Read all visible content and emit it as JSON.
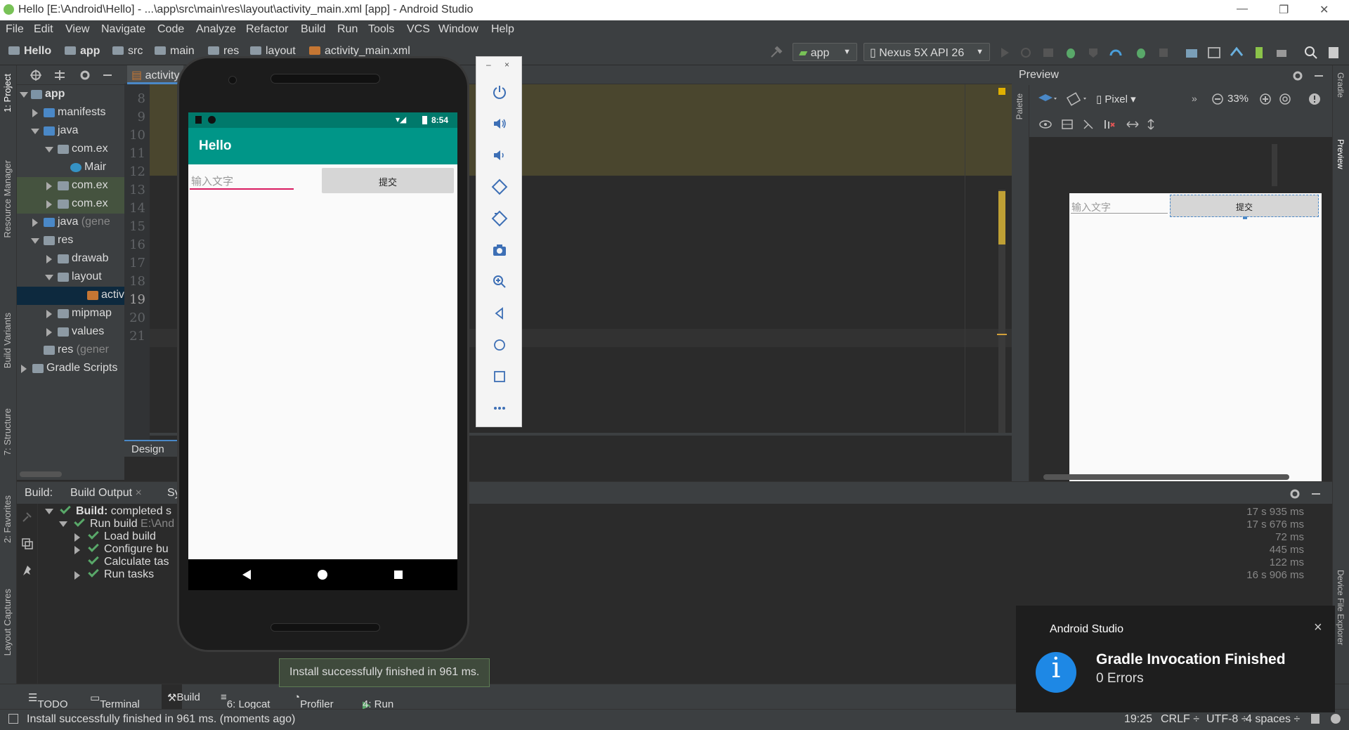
{
  "title_bar": {
    "title": "Hello [E:\\Android\\Hello] - ...\\app\\src\\main\\res\\layout\\activity_main.xml [app] - Android Studio",
    "minimize": "—",
    "restore": "❐",
    "close": "✕"
  },
  "menu": [
    "File",
    "Edit",
    "View",
    "Navigate",
    "Code",
    "Analyze",
    "Refactor",
    "Build",
    "Run",
    "Tools",
    "VCS",
    "Window",
    "Help"
  ],
  "breadcrumb": [
    "Hello",
    "app",
    "src",
    "main",
    "res",
    "layout",
    "activity_main.xml"
  ],
  "toolbar": {
    "run_config": "app",
    "device": "Nexus 5X API 26"
  },
  "left_tabs": [
    "1: Project",
    "Resource Manager",
    "Build Variants",
    "7: Structure",
    "2: Favorites",
    "Layout Captures"
  ],
  "right_tabs": [
    "Gradle",
    "Preview",
    "Device File Explorer"
  ],
  "project_tree": [
    {
      "label": "app",
      "depth": 0,
      "open": true,
      "bold": true
    },
    {
      "label": "manifests",
      "depth": 1,
      "open": false
    },
    {
      "label": "java",
      "depth": 1,
      "open": true
    },
    {
      "label": "com.ex",
      "depth": 2,
      "open": true
    },
    {
      "label": "Mair",
      "depth": 3,
      "leaf": true
    },
    {
      "label": "com.ex",
      "depth": 2,
      "open": false
    },
    {
      "label": "com.ex",
      "depth": 2,
      "open": false
    },
    {
      "label": "java",
      "suffix": " (gene",
      "depth": 1,
      "open": false
    },
    {
      "label": "res",
      "depth": 1,
      "open": true
    },
    {
      "label": "drawab",
      "depth": 2,
      "open": false
    },
    {
      "label": "layout",
      "depth": 2,
      "open": true
    },
    {
      "label": "activ",
      "depth": 3,
      "leaf": true,
      "selected": true
    },
    {
      "label": "mipmap",
      "depth": 2,
      "open": false
    },
    {
      "label": "values",
      "depth": 2,
      "open": false
    },
    {
      "label": "res",
      "suffix": " (gener",
      "depth": 1,
      "leaf": true
    },
    {
      "label": "Gradle Scripts",
      "depth": 0,
      "open": false
    }
  ],
  "editor": {
    "tab_label": "activity",
    "line_numbers": [
      "8",
      "9",
      "10",
      "11",
      "12",
      "13",
      "14",
      "15",
      "16",
      "17",
      "18",
      "19",
      "20",
      "21"
    ],
    "design_tab": "Design"
  },
  "emulator": {
    "status_time": "8:54",
    "app_title": "Hello",
    "input_placeholder": "输入文字",
    "submit_label": "提交"
  },
  "preview": {
    "title": "Preview",
    "palette": "Palette",
    "device": "Pixel",
    "zoom": "33%",
    "input_placeholder": "输入文字",
    "submit_label": "提交"
  },
  "build": {
    "label": "Build:",
    "tab_output": "Build Output",
    "tab_sync": "Sy",
    "rows": [
      {
        "label": "Build:",
        "rest": " completed s",
        "depth": 0,
        "time": "17 s 935 ms"
      },
      {
        "label": "Run build",
        "rest": " E:\\And",
        "depth": 1,
        "time": "17 s 676 ms"
      },
      {
        "label": "Load build",
        "rest": "",
        "depth": 2,
        "time": "72 ms"
      },
      {
        "label": "Configure bu",
        "rest": "",
        "depth": 2,
        "time": "445 ms"
      },
      {
        "label": "Calculate tas",
        "rest": "",
        "depth": 2,
        "time": "122 ms"
      },
      {
        "label": "Run tasks",
        "rest": "",
        "depth": 2,
        "time": "16 s 906 ms"
      }
    ]
  },
  "bottom_tabs": [
    {
      "key": "todo",
      "label": "TODO"
    },
    {
      "key": "terminal",
      "label": "Terminal"
    },
    {
      "key": "build",
      "label": "Build"
    },
    {
      "key": "logcat",
      "label": "6: Logcat"
    },
    {
      "key": "profiler",
      "label": "Profiler"
    },
    {
      "key": "run",
      "label": "4: Run"
    }
  ],
  "tooltip": "Install successfully finished in 961 ms.",
  "status_bar": {
    "message": "Install successfully finished in 961 ms. (moments ago)",
    "position": "19:25",
    "line_sep": "CRLF ÷",
    "encoding": "UTF-8 ÷",
    "indent": "4 spaces ÷"
  },
  "notification": {
    "app": "Android Studio",
    "title": "Gradle Invocation Finished",
    "body": "0 Errors"
  },
  "colors": {
    "accent": "#009688",
    "accent_dark": "#00796b",
    "ide_bg": "#2b2b2b",
    "panel_bg": "#3c3f41",
    "success": "#59a869",
    "info_blue": "#1e88e5"
  }
}
